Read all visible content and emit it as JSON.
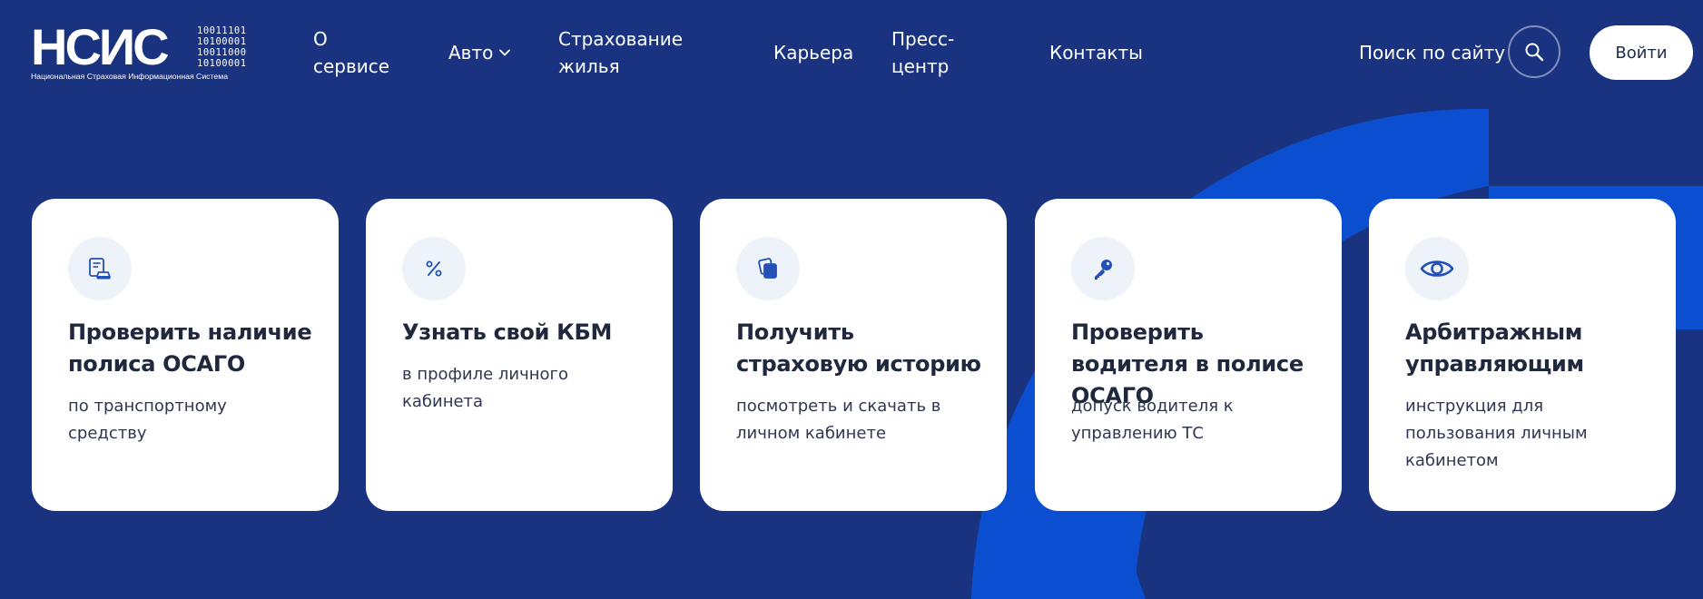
{
  "colors": {
    "background": "#1a3381",
    "accent_arc": "#0b4fd0",
    "card_bg": "#ffffff",
    "icon_bg": "#eef2f9",
    "icon_color": "#2451b8",
    "text_dark": "#20283e"
  },
  "logo": {
    "text": "НСИС",
    "binary": [
      "10011101",
      "10100001",
      "10011000",
      "10100001"
    ],
    "subtitle": "Национальная Страховая Информационная Система"
  },
  "nav": {
    "about": "О сервисе",
    "auto": "Авто",
    "housing": "Страхование жилья",
    "career": "Карьера",
    "press": "Пресс-центр",
    "contacts": "Контакты"
  },
  "header": {
    "search_label": "Поиск по сайту",
    "search_icon": "search-icon",
    "login_label": "Войти"
  },
  "cards": [
    {
      "icon": "document-car-icon",
      "title": "Проверить наличие полиса ОСАГО",
      "description": "по транспортному средству"
    },
    {
      "icon": "percent-icon",
      "title": "Узнать свой КБМ",
      "description": "в профиле личного кабинета"
    },
    {
      "icon": "documents-copy-icon",
      "title": "Получить страховую историю",
      "description": "посмотреть и скачать в личном кабинете"
    },
    {
      "icon": "key-icon",
      "title": "Проверить водителя в полисе ОСАГО",
      "description": "допуск водителя к управлению ТС"
    },
    {
      "icon": "eye-icon",
      "title": "Арбитражным управляющим",
      "description": "инструкция для пользования личным кабинетом"
    }
  ]
}
